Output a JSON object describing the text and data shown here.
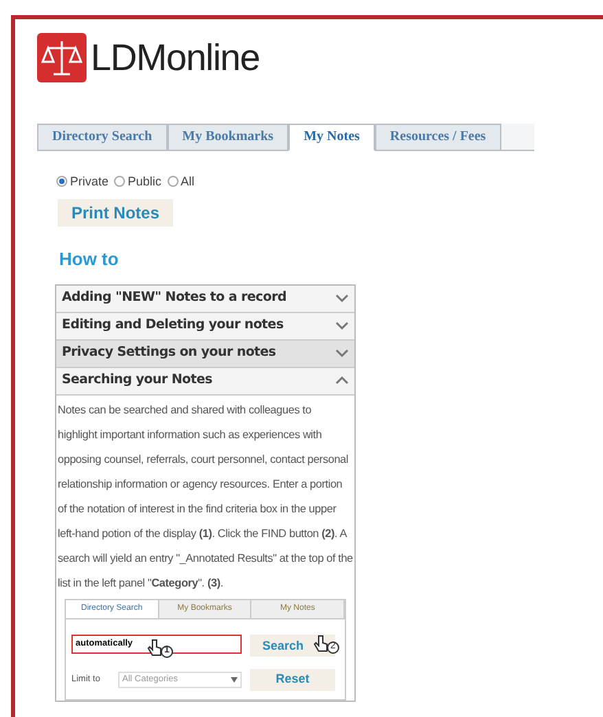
{
  "logo": {
    "text": "LDMonline"
  },
  "tabs": [
    {
      "label": "Directory Search",
      "selected": false
    },
    {
      "label": "My Bookmarks",
      "selected": false
    },
    {
      "label": "My Notes",
      "selected": true
    },
    {
      "label": "Resources / Fees",
      "selected": false
    }
  ],
  "visibility": [
    {
      "label": "Private",
      "selected": true
    },
    {
      "label": "Public",
      "selected": false
    },
    {
      "label": "All",
      "selected": false
    }
  ],
  "print_button": "Print Notes",
  "section_title": "How to",
  "accordion": [
    {
      "title": "Adding \"NEW\" Notes to a record",
      "expanded": false
    },
    {
      "title": "Editing and Deleting your notes",
      "expanded": false
    },
    {
      "title": "Privacy Settings on your notes",
      "expanded": false
    },
    {
      "title": "Searching your Notes",
      "expanded": true,
      "body": "Notes can be searched and shared with colleagues to highlight important information such as experiences with opposing counsel, referrals, court personnel, contact personal relationship information or agency resources. Enter a portion of the notation of interest in the find criteria box in the upper left-hand potion of the display **(1)**. Click the FIND button **(2)**. A search will yield an entry \"_Annotated Results\" at the top of the list in the left panel \"**Category**\". **(3)**."
    }
  ],
  "example": {
    "tabs": [
      {
        "label": "Directory Search",
        "selected": true
      },
      {
        "label": "My Bookmarks",
        "selected": false
      },
      {
        "label": "My Notes",
        "selected": false
      }
    ],
    "search_value": "automatically",
    "search_button": "Search",
    "reset_button": "Reset",
    "limit_label": "Limit to",
    "limit_value": "All Categories",
    "markers": [
      "1",
      "2"
    ]
  }
}
